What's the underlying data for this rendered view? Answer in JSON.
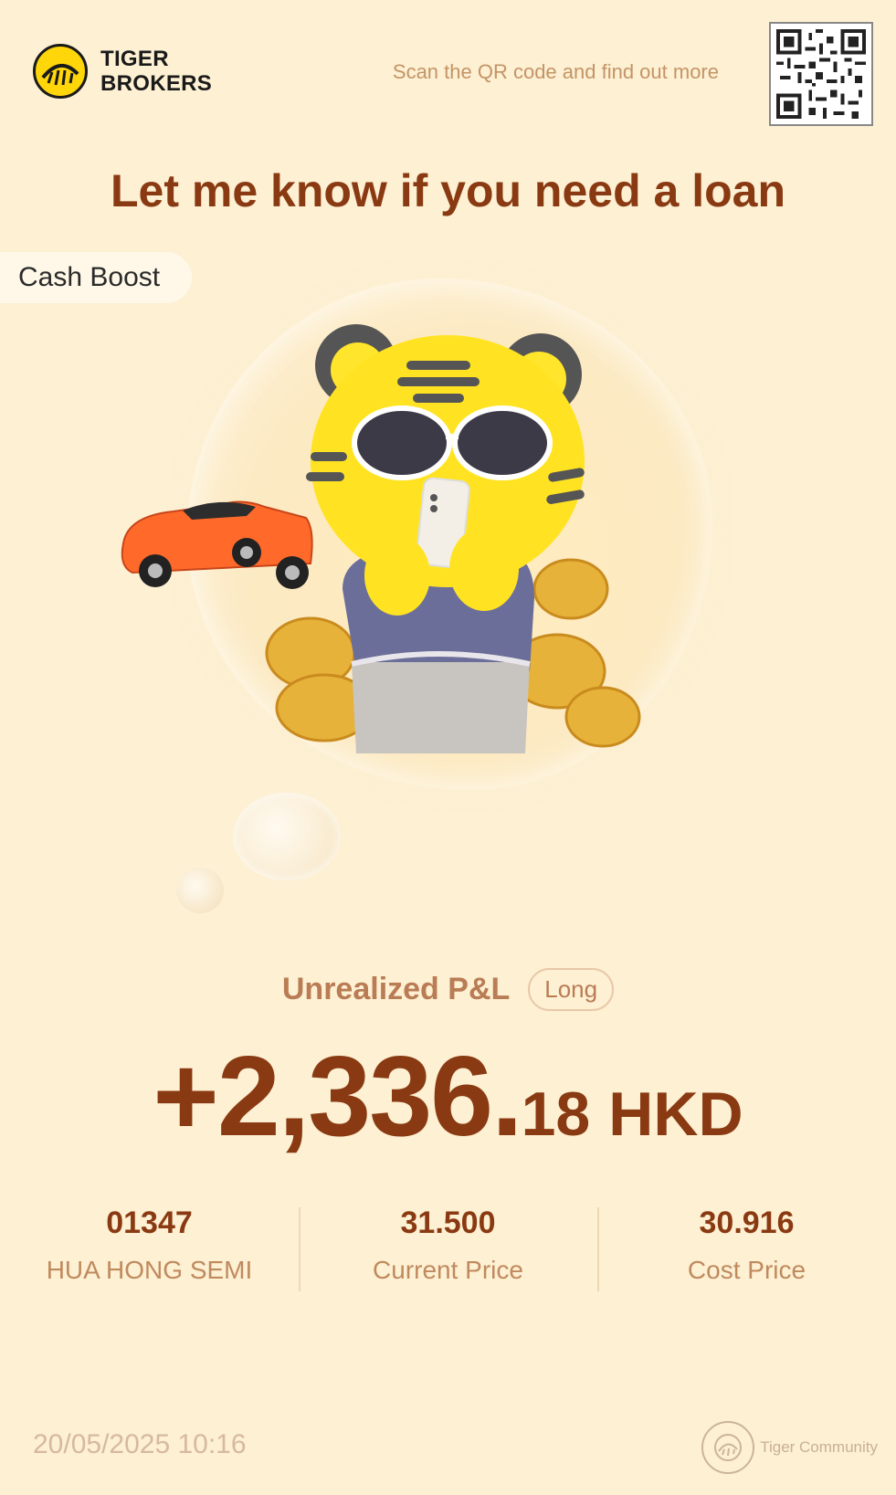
{
  "brand": {
    "name_line1": "TIGER",
    "name_line2": "BROKERS",
    "logo_icon": "tiger-logo-icon",
    "qr_hint": "Scan the QR code and find out more"
  },
  "headline": "Let me know if you need a loan",
  "tag": "Cash Boost",
  "illustration": {
    "subject": "tiger-mascot-with-phone",
    "elements": [
      "sunglasses",
      "smartphone",
      "sports-car",
      "gold-coins",
      "thought-bubble"
    ]
  },
  "pnl": {
    "label": "Unrealized P&L",
    "position_type": "Long",
    "value_int": "+2,336.",
    "value_dec": "18",
    "currency": "HKD"
  },
  "stats": [
    {
      "value": "01347",
      "label": "HUA HONG SEMI"
    },
    {
      "value": "31.500",
      "label": "Current Price"
    },
    {
      "value": "30.916",
      "label": "Cost Price"
    }
  ],
  "footer": {
    "timestamp": "20/05/2025 10:16",
    "community": "Tiger Community"
  },
  "colors": {
    "background": "#fdf0d3",
    "primary_text": "#8a3a12",
    "muted_text": "#c08a5e",
    "brand_yellow": "#ffd60a"
  }
}
